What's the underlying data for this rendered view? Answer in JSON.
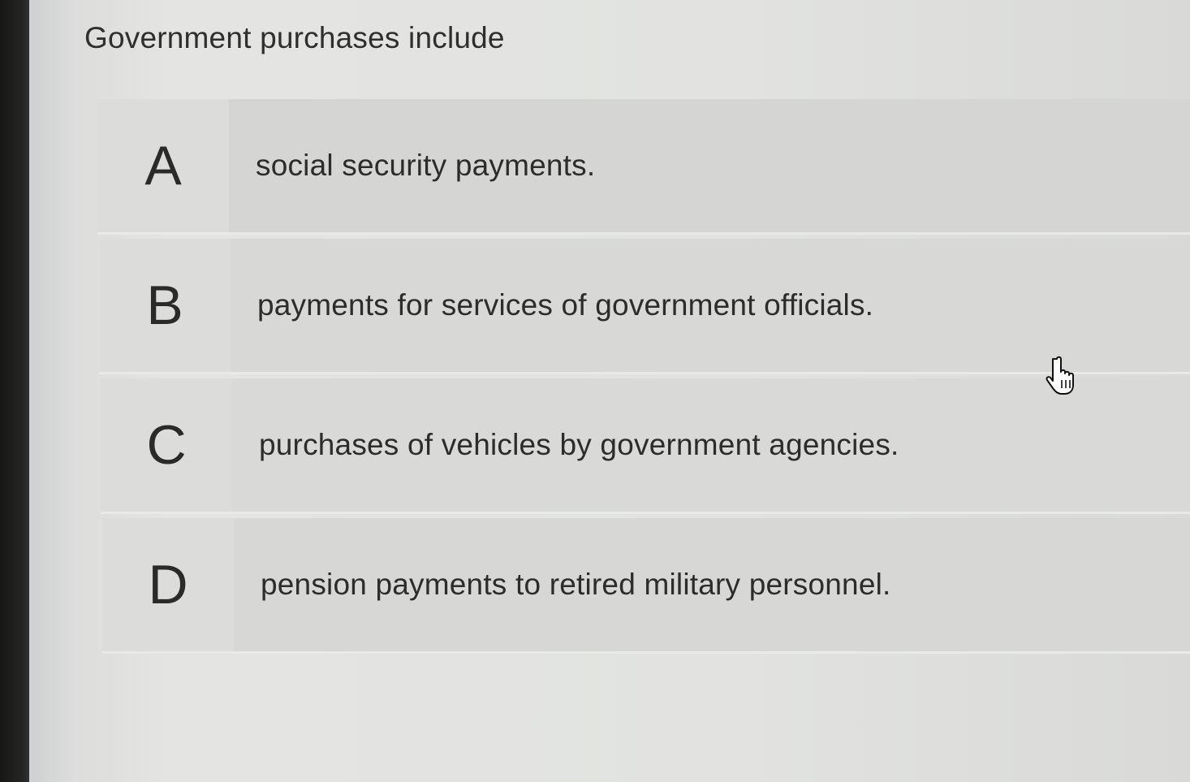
{
  "question": {
    "text": "Government purchases include"
  },
  "options": [
    {
      "letter": "A",
      "text": "social security payments."
    },
    {
      "letter": "B",
      "text": "payments for services of government officials."
    },
    {
      "letter": "C",
      "text": "purchases of vehicles by government agencies."
    },
    {
      "letter": "D",
      "text": "pension payments to retired military personnel."
    }
  ],
  "cursor": {
    "icon": "hand-pointer-icon"
  }
}
